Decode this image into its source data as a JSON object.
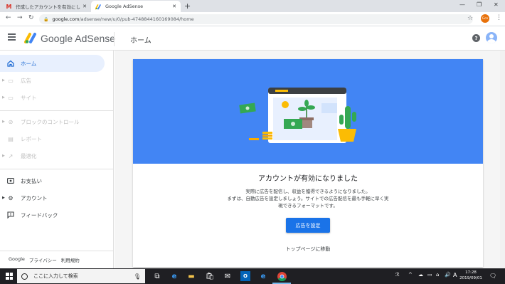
{
  "browser": {
    "tabs": [
      {
        "label": "作成したアカウントを有効にしましょう",
        "icon": "gmail-icon"
      },
      {
        "label": "Google AdSense",
        "icon": "adsense-icon"
      }
    ],
    "url_host": "google.com",
    "url_path": "/adsense/new/u/0/pub-4748844160169084/home",
    "profile_initials": "Gcn"
  },
  "header": {
    "brand": "Google AdSense",
    "page_title": "ホーム"
  },
  "sidebar": {
    "items": [
      {
        "label": "ホーム",
        "icon": "home-icon",
        "state": "active"
      },
      {
        "label": "広告",
        "icon": "ads-icon",
        "state": "disabled"
      },
      {
        "label": "サイト",
        "icon": "sites-icon",
        "state": "disabled"
      },
      {
        "label": "ブロックのコントロール",
        "icon": "block-icon",
        "state": "disabled"
      },
      {
        "label": "レポート",
        "icon": "reports-icon",
        "state": "disabled"
      },
      {
        "label": "最適化",
        "icon": "optimize-icon",
        "state": "disabled"
      },
      {
        "label": "お支払い",
        "icon": "payments-icon",
        "state": "enabled"
      },
      {
        "label": "アカウント",
        "icon": "account-gear-icon",
        "state": "enabled"
      },
      {
        "label": "フィードバック",
        "icon": "feedback-icon",
        "state": "enabled"
      }
    ],
    "footer": {
      "google": "Google",
      "privacy": "プライバシー",
      "terms": "利用規約"
    }
  },
  "main": {
    "card_title": "アカウントが有効になりました",
    "body_line1": "実際に広告を配信し、収益を獲得できるようになりました。",
    "body_line2": "まずは、自動広告を設定しましょう。サイトでの広告配信を最も手軽に早く実",
    "body_line3": "現できるフォーマットです。",
    "cta_label": "広告を設定",
    "secondary_link": "トップページに移動"
  },
  "taskbar": {
    "search_placeholder": "ここに入力して検索",
    "ime": "A",
    "time": "17:28",
    "date": "2019/09/01"
  },
  "colors": {
    "hero_blue": "#4285f4",
    "button_blue": "#1a73e8",
    "active_bg": "#e8f0fe",
    "active_text": "#1967d2"
  }
}
